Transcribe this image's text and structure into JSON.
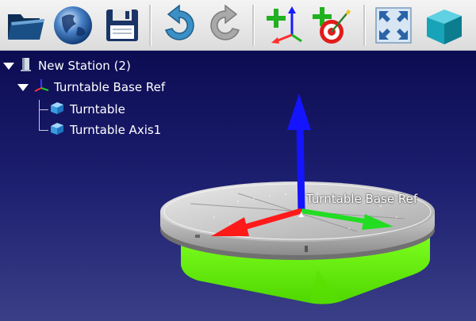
{
  "toolbar": {
    "buttons": [
      {
        "icon": "open-folder-icon",
        "tooltip": ""
      },
      {
        "icon": "globe-icon",
        "tooltip": ""
      },
      {
        "icon": "save-icon",
        "tooltip": ""
      },
      {
        "icon": "undo-icon",
        "tooltip": ""
      },
      {
        "icon": "redo-icon",
        "tooltip": ""
      },
      {
        "icon": "add-frame-icon",
        "tooltip": ""
      },
      {
        "icon": "add-target-icon",
        "tooltip": ""
      },
      {
        "icon": "fit-view-icon",
        "tooltip": ""
      },
      {
        "icon": "cube-view-icon",
        "tooltip": ""
      }
    ]
  },
  "tree": {
    "root": {
      "label": "New Station (2)",
      "icon": "station-icon",
      "expanded": true
    },
    "frame": {
      "label": "Turntable Base Ref",
      "icon": "frame-icon",
      "expanded": true
    },
    "children": [
      {
        "label": "Turntable",
        "icon": "part-icon"
      },
      {
        "label": "Turntable Axis1",
        "icon": "part-icon"
      }
    ]
  },
  "viewport": {
    "frame_label": "Turntable Base Ref",
    "colors": {
      "background_top": "#0c0c52",
      "background_bottom": "#3a3f86",
      "turntable_top": "#c9c9c9",
      "turntable_base": "#66ff00",
      "axis_x": "#ff1a1a",
      "axis_y": "#22dd22",
      "axis_z": "#1414ff"
    }
  }
}
